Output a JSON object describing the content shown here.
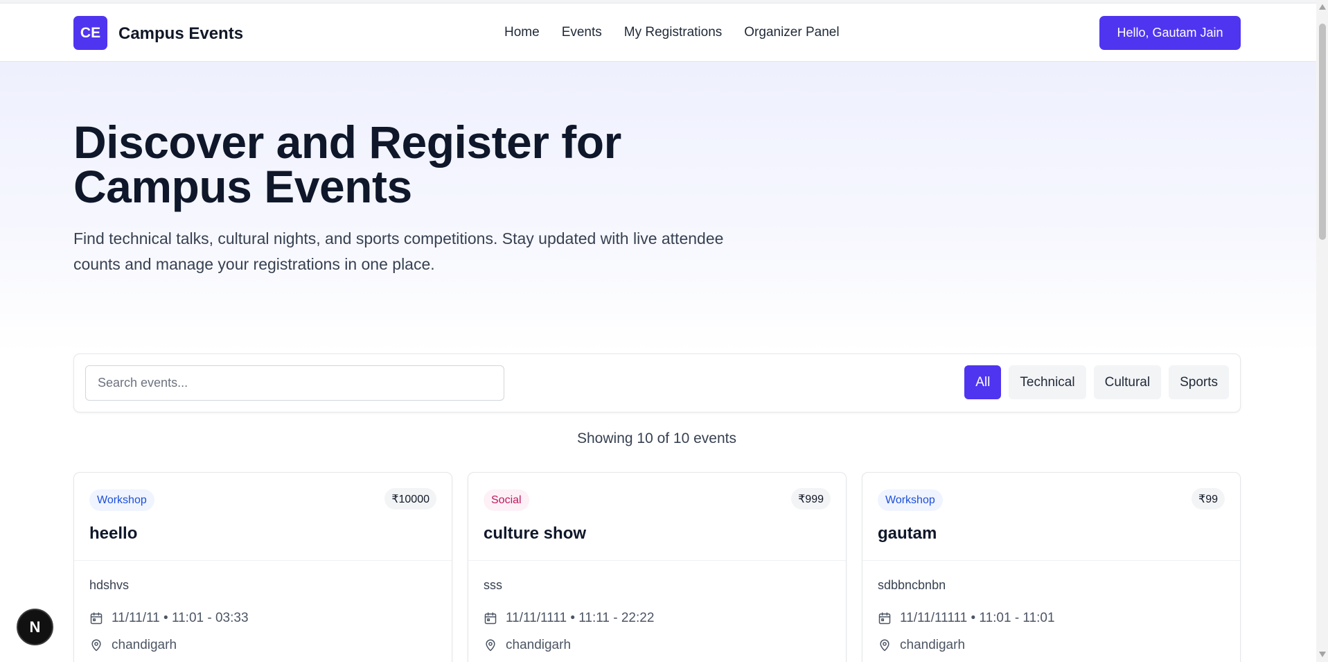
{
  "header": {
    "logo_text": "CE",
    "brand": "Campus Events",
    "nav": [
      "Home",
      "Events",
      "My Registrations",
      "Organizer Panel"
    ],
    "user_button": "Hello, Gautam Jain"
  },
  "hero": {
    "title": "Discover and Register for Campus Events",
    "subtitle": "Find technical talks, cultural nights, and sports competitions. Stay updated with live attendee counts and manage your registrations in one place."
  },
  "filters": {
    "search_placeholder": "Search events...",
    "search_value": "",
    "categories": [
      "All",
      "Technical",
      "Cultural",
      "Sports"
    ],
    "active_category": "All"
  },
  "results": {
    "showing": "Showing 10 of 10 events"
  },
  "events": [
    {
      "category": "Workshop",
      "price": "₹10000",
      "title": "heello",
      "description": "hdshvs",
      "datetime": "11/11/11 • 11:01 - 03:33",
      "location": "chandigarh"
    },
    {
      "category": "Social",
      "price": "₹999",
      "title": "culture show",
      "description": "sss",
      "datetime": "11/11/1111 • 11:11 - 22:22",
      "location": "chandigarh"
    },
    {
      "category": "Workshop",
      "price": "₹99",
      "title": "gautam",
      "description": "sdbbncbnbn",
      "datetime": "11/11/11111 • 11:01 - 11:01",
      "location": "chandigarh"
    }
  ],
  "dev_badge": "N",
  "colors": {
    "accent": "#4f35f0",
    "workshop_badge": "#1d4ed8",
    "social_badge": "#be185d"
  },
  "icons": {
    "date": "calendar-icon",
    "location": "map-pin-icon"
  }
}
